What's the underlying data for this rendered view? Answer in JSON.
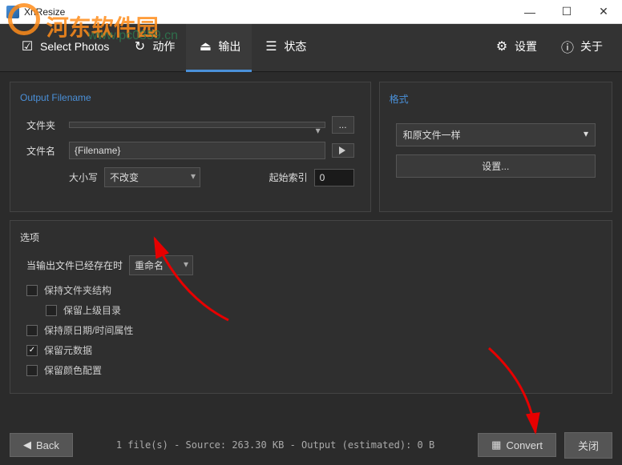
{
  "titlebar": {
    "title": "XnResize"
  },
  "watermark": {
    "text": "河东软件园",
    "url": "www.pc0359.cn"
  },
  "tabs": {
    "select_photos": "Select Photos",
    "action": "动作",
    "output": "输出",
    "status": "状态",
    "settings": "设置",
    "about": "关于"
  },
  "output_filename": {
    "title": "Output Filename",
    "folder_label": "文件夹",
    "folder_value": "",
    "browse": "...",
    "filename_label": "文件名",
    "filename_value": "{Filename}",
    "case_label": "大小写",
    "case_value": "不改变",
    "start_index_label": "起始索引",
    "start_index_value": "0"
  },
  "format": {
    "title": "格式",
    "value": "和原文件一样",
    "settings_btn": "设置..."
  },
  "options": {
    "title": "选项",
    "when_exists_label": "当输出文件已经存在时",
    "when_exists_value": "重命名",
    "keep_folder_structure": "保持文件夹结构",
    "keep_parent_dir": "保留上级目录",
    "keep_date_time": "保持原日期/时间属性",
    "keep_metadata": "保留元数据",
    "keep_color_profile": "保留颜色配置"
  },
  "status_bar": "1 file(s) - Source: 263.30 KB - Output (estimated): 0 B",
  "footer": {
    "back": "Back",
    "convert": "Convert",
    "close": "关闭"
  }
}
